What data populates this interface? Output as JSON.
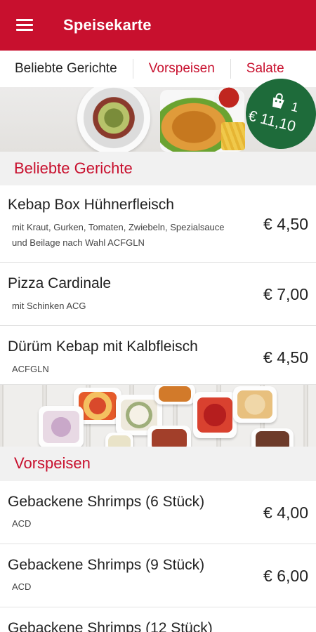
{
  "appbar": {
    "title": "Speisekarte",
    "menu_icon": "hamburger-menu-icon"
  },
  "tabs": [
    {
      "label": "Beliebte Gerichte"
    },
    {
      "label": "Vorspeisen"
    },
    {
      "label": "Salate"
    }
  ],
  "cart": {
    "count": "1",
    "total": "€ 11,10",
    "icon": "shopping-bag-icon",
    "color": "#1e6b3a"
  },
  "colors": {
    "accent": "#c8102e"
  },
  "sections": [
    {
      "title": "Beliebte Gerichte",
      "items": [
        {
          "name": "Kebap Box Hühnerfleisch",
          "desc": "mit Kraut, Gurken, Tomaten, Zwiebeln, Spezialsauce und Beilage nach Wahl  ACFGLN",
          "price": "€ 4,50"
        },
        {
          "name": "Pizza Cardinale",
          "desc": "mit Schinken ACG",
          "price": "€ 7,00"
        },
        {
          "name": "Dürüm Kebap mit Kalbfleisch",
          "desc": "ACFGLN",
          "price": "€ 4,50"
        }
      ]
    },
    {
      "title": "Vorspeisen",
      "items": [
        {
          "name": "Gebackene Shrimps (6 Stück)",
          "desc": "ACD",
          "price": "€ 4,00"
        },
        {
          "name": "Gebackene Shrimps (9 Stück)",
          "desc": "ACD",
          "price": "€ 6,00"
        },
        {
          "name": "Gebackene Shrimps (12 Stück)",
          "desc": "",
          "price": ""
        }
      ]
    }
  ]
}
